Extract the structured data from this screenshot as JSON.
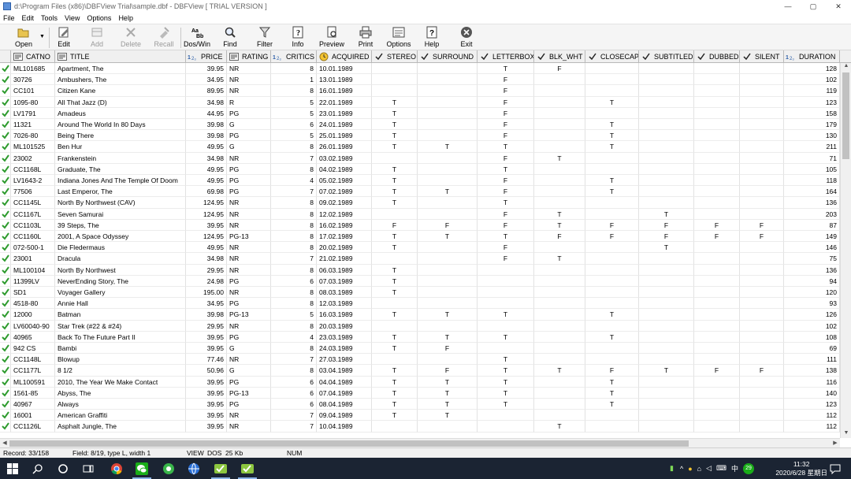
{
  "window": {
    "title": "d:\\Program Files (x86)\\DBFView Trial\\sample.dbf - DBFView [ TRIAL VERSION ]",
    "minimize": "—",
    "maximize": "▢",
    "close": "✕"
  },
  "menu": [
    "File",
    "Edit",
    "Tools",
    "View",
    "Options",
    "Help"
  ],
  "toolbar": {
    "open": "Open",
    "edit": "Edit",
    "add": "Add",
    "delete": "Delete",
    "recall": "Recall",
    "dos_win": "Dos/Win",
    "find": "Find",
    "filter": "Filter",
    "info": "Info",
    "preview": "Preview",
    "print": "Print",
    "options": "Options",
    "help": "Help",
    "exit": "Exit"
  },
  "columns": [
    "CATNO",
    "TITLE",
    "PRICE",
    "RATING",
    "CRITICS",
    "ACQUIRED",
    "STEREO",
    "SURROUND",
    "LETTERBOX",
    "BLK_WHT",
    "CLOSECAP",
    "SUBTITLED",
    "DUBBED",
    "SILENT",
    "DURATION"
  ],
  "rows": [
    [
      "ML101685",
      "Apartment, The",
      "39.95",
      "NR",
      "8",
      "10.01.1989",
      "",
      "",
      "T",
      "F",
      "",
      "",
      "",
      "",
      "128"
    ],
    [
      "30726",
      "Ambushers, The",
      "34.95",
      "NR",
      "1",
      "13.01.1989",
      "",
      "",
      "F",
      "",
      "",
      "",
      "",
      "",
      "102"
    ],
    [
      "CC101",
      "Citizen Kane",
      "89.95",
      "NR",
      "8",
      "16.01.1989",
      "",
      "",
      "F",
      "",
      "",
      "",
      "",
      "",
      "119"
    ],
    [
      "1095-80",
      "All That Jazz (D)",
      "34.98",
      "R",
      "5",
      "22.01.1989",
      "T",
      "",
      "F",
      "",
      "T",
      "",
      "",
      "",
      "123"
    ],
    [
      "LV1791",
      "Amadeus",
      "44.95",
      "PG",
      "5",
      "23.01.1989",
      "T",
      "",
      "F",
      "",
      "",
      "",
      "",
      "",
      "158"
    ],
    [
      "11321",
      "Around The World In 80 Days",
      "39.98",
      "G",
      "6",
      "24.01.1989",
      "T",
      "",
      "F",
      "",
      "T",
      "",
      "",
      "",
      "179"
    ],
    [
      "7026-80",
      "Being There",
      "39.98",
      "PG",
      "5",
      "25.01.1989",
      "T",
      "",
      "F",
      "",
      "T",
      "",
      "",
      "",
      "130"
    ],
    [
      "ML101525",
      "Ben Hur",
      "49.95",
      "G",
      "8",
      "26.01.1989",
      "T",
      "T",
      "T",
      "",
      "T",
      "",
      "",
      "",
      "211"
    ],
    [
      "23002",
      "Frankenstein",
      "34.98",
      "NR",
      "7",
      "03.02.1989",
      "",
      "",
      "F",
      "T",
      "",
      "",
      "",
      "",
      "71"
    ],
    [
      "CC1168L",
      "Graduate, The",
      "49.95",
      "PG",
      "8",
      "04.02.1989",
      "T",
      "",
      "T",
      "",
      "",
      "",
      "",
      "",
      "105"
    ],
    [
      "LV1643-2",
      "Indiana Jones And The Temple Of Doom",
      "49.95",
      "PG",
      "4",
      "05.02.1989",
      "T",
      "",
      "F",
      "",
      "T",
      "",
      "",
      "",
      "118"
    ],
    [
      "77506",
      "Last Emperor, The",
      "69.98",
      "PG",
      "7",
      "07.02.1989",
      "T",
      "T",
      "F",
      "",
      "T",
      "",
      "",
      "",
      "164"
    ],
    [
      "CC1145L",
      "North By Northwest  (CAV)",
      "124.95",
      "NR",
      "8",
      "09.02.1989",
      "T",
      "",
      "T",
      "",
      "",
      "",
      "",
      "",
      "136"
    ],
    [
      "CC1167L",
      "Seven Samurai",
      "124.95",
      "NR",
      "8",
      "12.02.1989",
      "",
      "",
      "F",
      "T",
      "",
      "T",
      "",
      "",
      "203"
    ],
    [
      "CC1103L",
      "39 Steps, The",
      "39.95",
      "NR",
      "8",
      "16.02.1989",
      "F",
      "F",
      "F",
      "T",
      "F",
      "F",
      "F",
      "F",
      "87"
    ],
    [
      "CC1160L",
      "2001, A Space Odyssey",
      "124.95",
      "PG-13",
      "8",
      "17.02.1989",
      "T",
      "T",
      "T",
      "F",
      "F",
      "F",
      "F",
      "F",
      "149"
    ],
    [
      "072-500-1",
      "Die Fledermaus",
      "49.95",
      "NR",
      "8",
      "20.02.1989",
      "T",
      "",
      "F",
      "",
      "",
      "T",
      "",
      "",
      "146"
    ],
    [
      "23001",
      "Dracula",
      "34.98",
      "NR",
      "7",
      "21.02.1989",
      "",
      "",
      "F",
      "T",
      "",
      "",
      "",
      "",
      "75"
    ],
    [
      "ML100104",
      "North By Northwest",
      "29.95",
      "NR",
      "8",
      "06.03.1989",
      "T",
      "",
      "",
      "",
      "",
      "",
      "",
      "",
      "136"
    ],
    [
      "11399LV",
      "NeverEnding Story, The",
      "24.98",
      "PG",
      "6",
      "07.03.1989",
      "T",
      "",
      "",
      "",
      "",
      "",
      "",
      "",
      "94"
    ],
    [
      "SD1",
      "Voyager Gallery",
      "195.00",
      "NR",
      "8",
      "08.03.1989",
      "T",
      "",
      "",
      "",
      "",
      "",
      "",
      "",
      "120"
    ],
    [
      "4518-80",
      "Annie Hall",
      "34.95",
      "PG",
      "8",
      "12.03.1989",
      "",
      "",
      "",
      "",
      "",
      "",
      "",
      "",
      "93"
    ],
    [
      "12000",
      "Batman",
      "39.98",
      "PG-13",
      "5",
      "16.03.1989",
      "T",
      "T",
      "T",
      "",
      "T",
      "",
      "",
      "",
      "126"
    ],
    [
      "LV60040-90",
      "Star Trek (#22 & #24)",
      "29.95",
      "NR",
      "8",
      "20.03.1989",
      "",
      "",
      "",
      "",
      "",
      "",
      "",
      "",
      "102"
    ],
    [
      "40965",
      "Back To The Future Part II",
      "39.95",
      "PG",
      "4",
      "23.03.1989",
      "T",
      "T",
      "T",
      "",
      "T",
      "",
      "",
      "",
      "108"
    ],
    [
      "942 CS",
      "Bambi",
      "39.95",
      "G",
      "8",
      "24.03.1989",
      "T",
      "F",
      "",
      "",
      "",
      "",
      "",
      "",
      "69"
    ],
    [
      "CC1148L",
      "Blowup",
      "77.46",
      "NR",
      "7",
      "27.03.1989",
      "",
      "",
      "T",
      "",
      "",
      "",
      "",
      "",
      "111"
    ],
    [
      "CC1177L",
      "8 1/2",
      "50.96",
      "G",
      "8",
      "03.04.1989",
      "T",
      "F",
      "T",
      "T",
      "F",
      "T",
      "F",
      "F",
      "138"
    ],
    [
      "ML100591",
      "2010, The Year We Make Contact",
      "39.95",
      "PG",
      "6",
      "04.04.1989",
      "T",
      "T",
      "T",
      "",
      "T",
      "",
      "",
      "",
      "116"
    ],
    [
      "1561-85",
      "Abyss, The",
      "39.95",
      "PG-13",
      "6",
      "07.04.1989",
      "T",
      "T",
      "T",
      "",
      "T",
      "",
      "",
      "",
      "140"
    ],
    [
      "40967",
      "Always",
      "39.95",
      "PG",
      "6",
      "08.04.1989",
      "T",
      "T",
      "T",
      "",
      "T",
      "",
      "",
      "",
      "123"
    ],
    [
      "16001",
      "American Graffiti",
      "39.95",
      "NR",
      "7",
      "09.04.1989",
      "T",
      "T",
      "",
      "",
      "",
      "",
      "",
      "",
      "112"
    ],
    [
      "CC1126L",
      "Asphalt Jungle, The",
      "39.95",
      "NR",
      "7",
      "10.04.1989",
      "",
      "",
      "",
      "T",
      "",
      "",
      "",
      "",
      "112"
    ]
  ],
  "status": {
    "record": "Record: 33/158",
    "field": "Field: 8/19, type L, width 1",
    "view": "VIEW",
    "dos": "DOS",
    "size": "25 Kb",
    "num": "NUM"
  },
  "taskbar": {
    "time": "11:32",
    "date": "2020/6/28 星期日",
    "lang": "中",
    "badge": "29"
  },
  "colors": {
    "check": "#2e9b2e",
    "taskbar": "#1b2433",
    "toolbar": "#f5f5f5"
  }
}
